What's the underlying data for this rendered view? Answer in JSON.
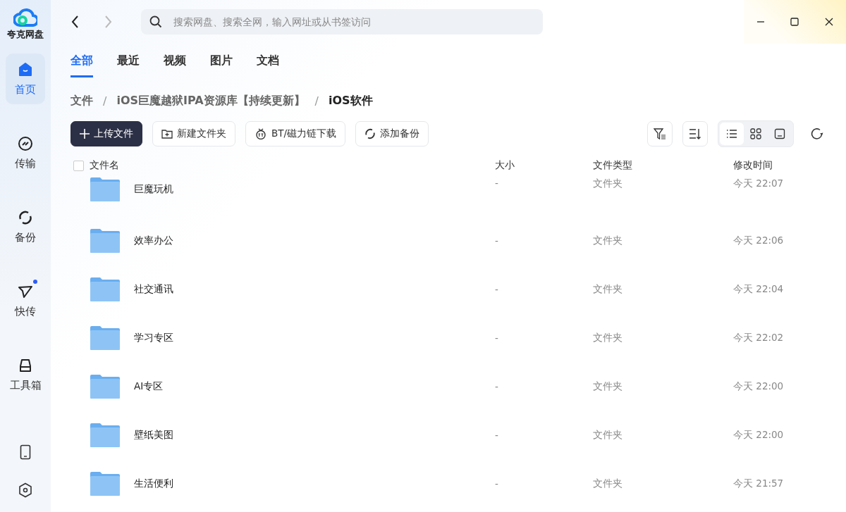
{
  "app": {
    "name": "夸克网盘"
  },
  "sidebar": {
    "items": [
      {
        "kind": "home",
        "label": "首页",
        "selected": true,
        "dot": false
      },
      {
        "kind": "transfer",
        "label": "传输",
        "selected": false,
        "dot": false
      },
      {
        "kind": "backup",
        "label": "备份",
        "selected": false,
        "dot": false
      },
      {
        "kind": "send",
        "label": "快传",
        "selected": false,
        "dot": true
      },
      {
        "kind": "toolbox",
        "label": "工具箱",
        "selected": false,
        "dot": false
      }
    ]
  },
  "search": {
    "placeholder": "搜索网盘、搜索全网，输入网址或从书签访问"
  },
  "tabs": [
    {
      "label": "全部",
      "selected": true
    },
    {
      "label": "最近",
      "selected": false
    },
    {
      "label": "视频",
      "selected": false
    },
    {
      "label": "图片",
      "selected": false
    },
    {
      "label": "文档",
      "selected": false
    }
  ],
  "breadcrumb": [
    {
      "kind": "link",
      "text": "文件"
    },
    {
      "kind": "separator",
      "text": "/"
    },
    {
      "kind": "link",
      "text": "iOS巨魔越狱IPA资源库【持续更新】"
    },
    {
      "kind": "separator",
      "text": "/"
    },
    {
      "kind": "current",
      "text": "iOS软件"
    }
  ],
  "toolbar": {
    "actions": [
      {
        "kind": "upload",
        "label": "上传文件"
      },
      {
        "kind": "new-folder",
        "label": "新建文件夹"
      },
      {
        "kind": "bt",
        "label": "BT/磁力链下载"
      },
      {
        "kind": "backup",
        "label": "添加备份"
      }
    ],
    "views": [
      {
        "kind": "list",
        "selected": true
      },
      {
        "kind": "grid",
        "selected": false
      },
      {
        "kind": "preview",
        "selected": false
      }
    ]
  },
  "table": {
    "select_all": {
      "checked": false
    },
    "columns": [
      "文件名",
      "大小",
      "文件类型",
      "修改时间"
    ],
    "rows": [
      {
        "name": "巨魔玩机",
        "size": "-",
        "type": "文件夹",
        "modified": "今天 22:07"
      },
      {
        "name": "效率办公",
        "size": "-",
        "type": "文件夹",
        "modified": "今天 22:06"
      },
      {
        "name": "社交通讯",
        "size": "-",
        "type": "文件夹",
        "modified": "今天 22:04"
      },
      {
        "name": "学习专区",
        "size": "-",
        "type": "文件夹",
        "modified": "今天 22:02"
      },
      {
        "name": "AI专区",
        "size": "-",
        "type": "文件夹",
        "modified": "今天 22:00"
      },
      {
        "name": "壁纸美图",
        "size": "-",
        "type": "文件夹",
        "modified": "今天 22:00"
      },
      {
        "name": "生活便利",
        "size": "-",
        "type": "文件夹",
        "modified": "今天 21:57"
      }
    ]
  }
}
